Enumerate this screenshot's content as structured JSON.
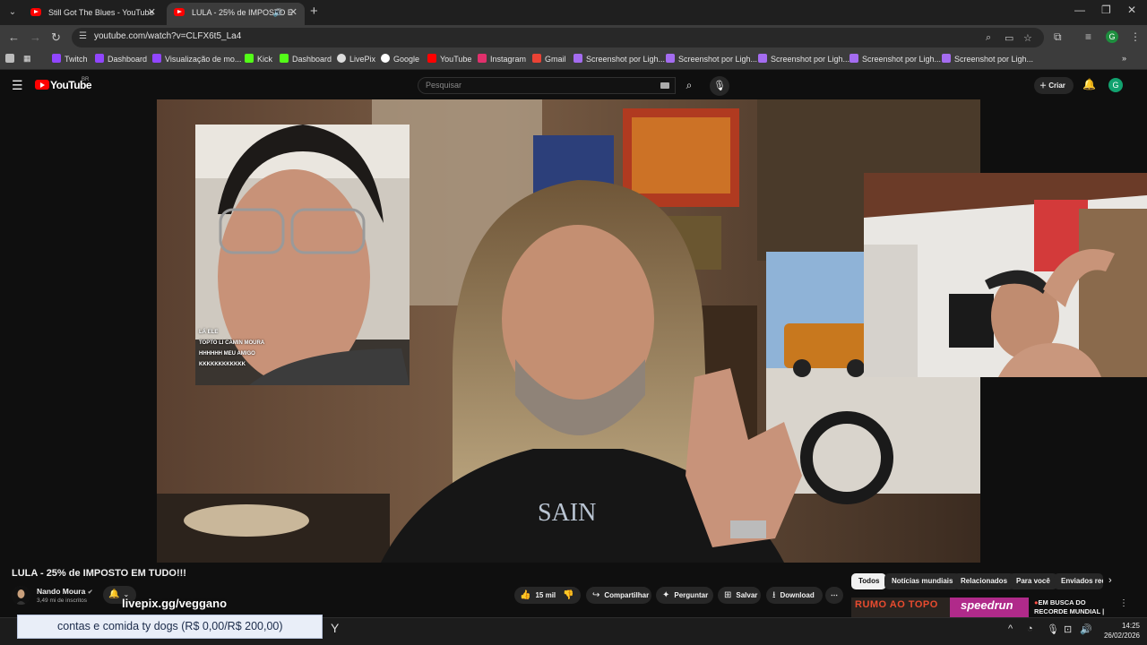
{
  "browser": {
    "tabs": [
      {
        "title": "Still Got The Blues - YouTube",
        "active": false
      },
      {
        "title": "LULA - 25% de IMPOSTO E",
        "active": true
      }
    ],
    "url": "youtube.com/watch?v=CLFX6t5_La4",
    "profile_initial": "G",
    "bookmarks": [
      "Twitch",
      "Dashboard",
      "Visualização de mo...",
      "Kick",
      "Dashboard",
      "LivePix",
      "Google",
      "YouTube",
      "Instagram",
      "Gmail",
      "Screenshot por Ligh...",
      "Screenshot por Ligh...",
      "Screenshot por Ligh...",
      "Screenshot por Ligh...",
      "Screenshot por Ligh..."
    ]
  },
  "youtube": {
    "logo_text": "YouTube",
    "logo_badge": "BR",
    "search_placeholder": "Pesquisar",
    "create_label": "Criar",
    "avatar_initial": "G"
  },
  "video": {
    "title": "LULA - 25% de IMPOSTO EM TUDO!!!",
    "channel": "Nando Moura",
    "subscribers": "3,49 mi de inscritos",
    "overlay_link": "livepix.gg/veggano",
    "likes": "15 mil",
    "actions": {
      "share": "Compartilhar",
      "ask": "Perguntar",
      "save": "Salvar",
      "download": "Download"
    },
    "pip_chat_lines": [
      "LÁ ELE",
      "TOPTO LI CAMIN MOURA",
      "HHHHHH MEU AMIGO",
      "KKKKKKKKKKKK"
    ]
  },
  "sidebar": {
    "chips": [
      "Todos",
      "Notícias mundiais",
      "Relacionados",
      "Para você",
      "Enviados rec"
    ],
    "recommendation": {
      "thumb_text": "RUMO AO TOPO",
      "thumb_brand": "speedrun",
      "title": "EM BUSCA DO RECORDE MUNDIAL | GT..."
    }
  },
  "taskbar": {
    "ticker": "contas e comida ty dogs (R$ 0,00/R$ 200,00)",
    "time": "14:25",
    "date": "26/02/2026"
  }
}
